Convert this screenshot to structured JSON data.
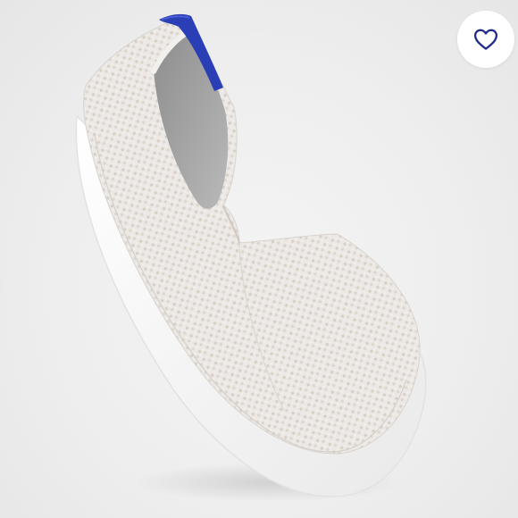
{
  "product_image": {
    "icon": "slip-on-knit-sneaker",
    "upper_color": "#e9e6e3",
    "speckle_color": "#cfc7bb",
    "sole_color": "#fafafa",
    "heel_tab_color": "#2a3fb5"
  },
  "like_button": {
    "icon": "heart-outline-icon",
    "icon_color": "#1f2a8a",
    "background": "#ffffff"
  }
}
